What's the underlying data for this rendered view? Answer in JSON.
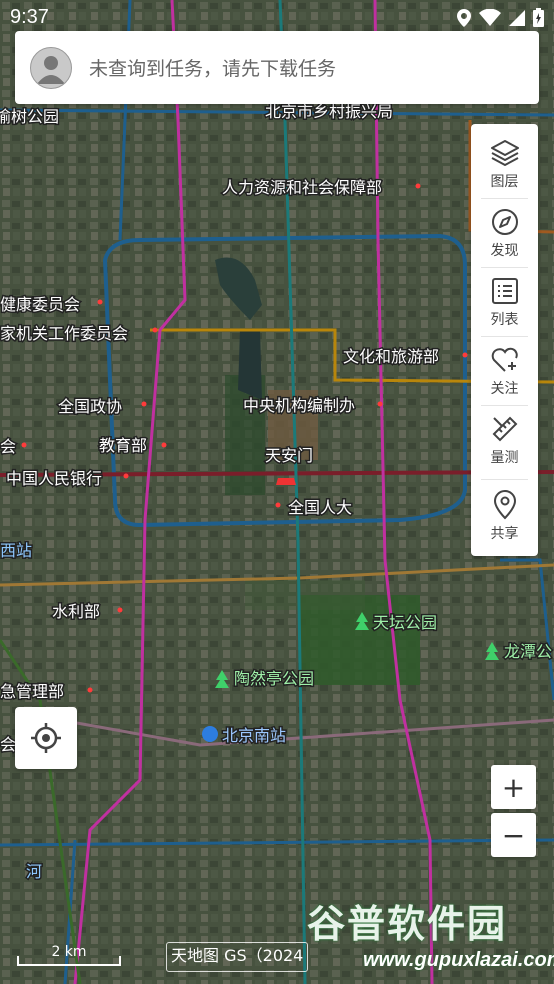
{
  "status": {
    "time": "9:37"
  },
  "search": {
    "placeholder": "未查询到任务，请先下载任务"
  },
  "toolbar": {
    "layers": "图层",
    "discover": "发现",
    "list": "列表",
    "follow": "关注",
    "measure": "量测",
    "share": "共享"
  },
  "map": {
    "labels": {
      "l1": "北京市乡村振兴局",
      "l2": "人力资源和社会保障部",
      "l3": "健康委员会",
      "l4": "家机关工作委员会",
      "l5": "文化和旅游部",
      "l6": "全国政协",
      "l7": "中央机构编制办",
      "l8": "教育部",
      "l9": "天安门",
      "l10": "中国人民银行",
      "l11": "全国人大",
      "l12": "西站",
      "l13": "水利部",
      "l14": "天坛公园",
      "l15": "龙潭公",
      "l16": "陶然亭公园",
      "l17": "急管理部",
      "l18": "北京南站",
      "l19": "河",
      "l20": "榆树公园",
      "l21": "会",
      "l22": "会"
    }
  },
  "zoom": {
    "in": "+",
    "out": "−"
  },
  "scale": "2 km",
  "attribution": "天地图 GS（2024",
  "watermark": {
    "name": "谷普软件园",
    "url": "www.gupuxlazai.com"
  },
  "colors": {
    "accent": "#3a8df5",
    "road_ring": "#1a5c8c",
    "road_main": "#b8860b",
    "rail": "#c030a0"
  }
}
